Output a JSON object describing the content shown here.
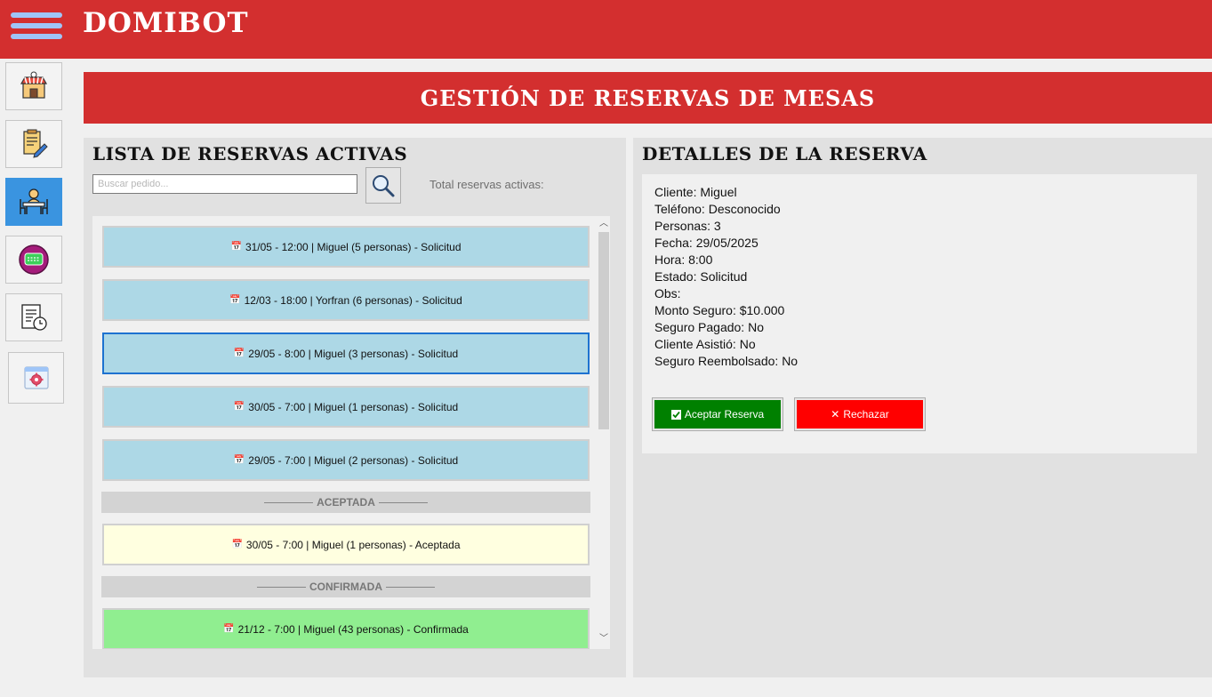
{
  "app": {
    "brand": "DOMIBOT"
  },
  "sidebar": {
    "items": [
      {
        "icon": "restaurant-icon"
      },
      {
        "icon": "order-edit-icon"
      },
      {
        "icon": "table-reservation-icon",
        "active": true
      },
      {
        "icon": "chat-icon"
      },
      {
        "icon": "report-history-icon"
      },
      {
        "icon": "settings-icon"
      }
    ]
  },
  "page": {
    "title": "GESTIÓN DE RESERVAS DE MESAS"
  },
  "list": {
    "title": "LISTA DE RESERVAS ACTIVAS",
    "search_placeholder": "Buscar pedido...",
    "search_value": "",
    "total_label": "Total reservas activas:",
    "reservations": [
      {
        "text": "31/05 - 12:00 | Miguel (5 personas) - Solicitud"
      },
      {
        "text": "12/03 - 18:00 | Yorfran (6 personas) - Solicitud"
      },
      {
        "text": "29/05 - 8:00 | Miguel (3 personas) - Solicitud"
      },
      {
        "text": "30/05 - 7:00 | Miguel (1 personas) - Solicitud"
      },
      {
        "text": "29/05 - 7:00 | Miguel (2 personas) - Solicitud"
      }
    ],
    "groups": [
      {
        "label": "ACEPTADA",
        "items": [
          {
            "text": "30/05 - 7:00 | Miguel (1 personas) - Aceptada"
          }
        ]
      },
      {
        "label": "CONFIRMADA",
        "items": [
          {
            "text": "21/12 - 7:00 | Miguel (43 personas) - Confirmada"
          }
        ]
      }
    ]
  },
  "details": {
    "title": "DETALLES DE LA RESERVA",
    "lines": [
      "Cliente: Miguel",
      "Teléfono: Desconocido",
      "Personas: 3",
      "Fecha: 29/05/2025",
      "Hora: 8:00",
      "Estado: Solicitud",
      "Obs:",
      "Monto Seguro: $10.000",
      "Seguro Pagado: No",
      "Cliente Asistió: No",
      "Seguro Reembolsado: No"
    ],
    "accept_label": "Aceptar Reserva",
    "reject_label": "Rechazar"
  },
  "colors": {
    "brand_red": "#d32f2f",
    "solicitud": "#add8e6",
    "aceptada": "#ffffe0",
    "confirmada": "#90ee90",
    "accept_green": "#008000",
    "reject_red": "#ff0000",
    "active_nav": "#3a94e0"
  }
}
